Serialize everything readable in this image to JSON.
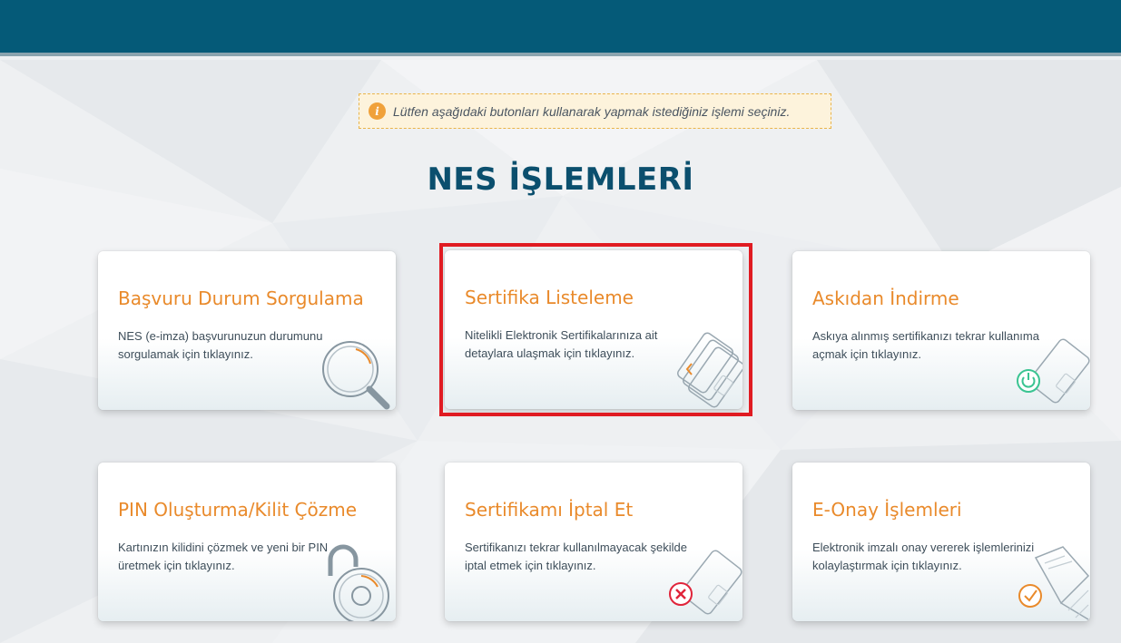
{
  "notice": {
    "text": "Lütfen aşağıdaki butonları kullanarak yapmak istediğiniz işlemi seçiniz.",
    "icon": "info-icon"
  },
  "page_title": "NES İŞLEMLERİ",
  "cards": [
    {
      "title": "Başvuru Durum Sorgulama",
      "description": "NES (e-imza) başvurunuzun durumunu sorgulamak için tıklayınız.",
      "icon": "magnifier-icon"
    },
    {
      "title": "Sertifika Listeleme",
      "description": "Nitelikli Elektronik Sertifikalarınıza ait detaylara ulaşmak için tıklayınız.",
      "icon": "card-list-icon",
      "selected": true
    },
    {
      "title": "Askıdan İndirme",
      "description": "Askıya alınmış sertifikanızı tekrar kullanıma açmak için tıklayınız.",
      "icon": "card-power-icon"
    },
    {
      "title": "PIN Oluşturma/Kilit Çözme",
      "description": "Kartınızın kilidini çözmek ve yeni bir PIN üretmek için tıklayınız.",
      "icon": "padlock-icon"
    },
    {
      "title": "Sertifikamı İptal Et",
      "description": "Sertifikanızı tekrar kullanılmayacak şekilde iptal etmek için tıklayınız.",
      "icon": "card-cancel-icon"
    },
    {
      "title": "E-Onay İşlemleri",
      "description": "Elektronik imzalı onay vererek işlemlerinizi kolaylaştırmak için tıklayınız.",
      "icon": "document-check-icon"
    }
  ],
  "colors": {
    "header": "#055a78",
    "title": "#0b4f6e",
    "card_title": "#e98a2b",
    "selection": "#e01b22",
    "notice_bg": "#fdf3dc"
  }
}
